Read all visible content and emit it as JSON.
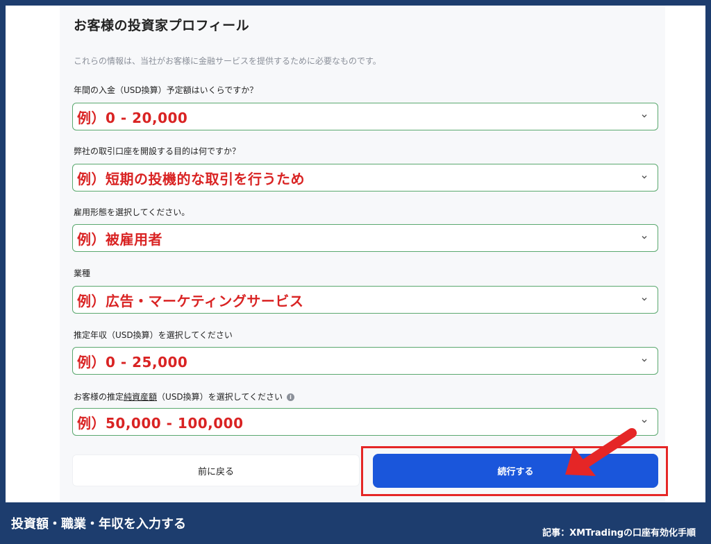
{
  "form": {
    "title": "お客様の投資家プロフィール",
    "subtitle": "これらの情報は、当社がお客様に金融サービスを提供するために必要なものです。",
    "fields": [
      {
        "label": "年間の入金（USD換算）予定額はいくらですか？",
        "value": "例）0 - 20,000"
      },
      {
        "label": "弊社の取引口座を開設する目的は何ですか？",
        "value": "例）短期の投機的な取引を行うため"
      },
      {
        "label": "雇用形態を選択してください。",
        "value": "例）被雇用者"
      },
      {
        "label": "業種",
        "value": "例）広告・マーケティングサービス"
      },
      {
        "label": "推定年収（USD換算）を選択してください",
        "value": "例）0 - 25,000"
      },
      {
        "label_prefix": "お客様の推定",
        "label_underlined": "純資産額",
        "label_suffix": "（USD換算）を選択してください",
        "value": "例）50,000 - 100,000",
        "info_icon": "info-icon"
      }
    ],
    "back_label": "前に戻る",
    "continue_label": "続行する"
  },
  "caption": "投資額・職業・年収を入力する",
  "credit": "記事：XMTradingの口座有効化手順",
  "colors": {
    "background": "#1d3d6e",
    "accent": "#1a56db",
    "highlight": "#e52626",
    "value_text": "#d92323",
    "field_border": "#5aa86e"
  }
}
